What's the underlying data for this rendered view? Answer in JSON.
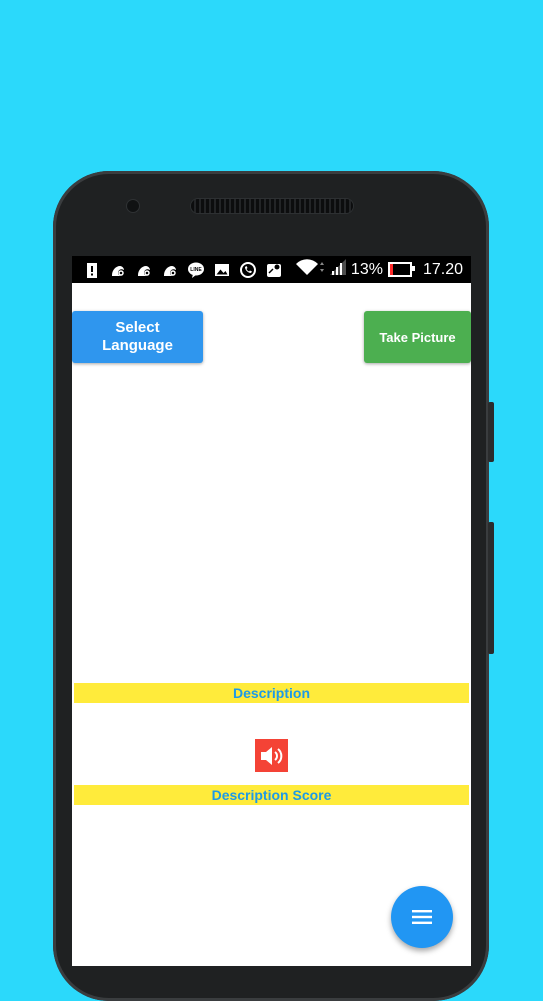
{
  "statusbar": {
    "battery_percent": "13%",
    "battery_level": 0.13,
    "time": "17.20",
    "notification_icons": [
      "alert-icon",
      "uc-browser-icon",
      "uc-browser-icon",
      "uc-browser-icon",
      "line-app-icon",
      "gallery-icon",
      "whatsapp-icon",
      "maps-icon"
    ],
    "line_label": "LINE"
  },
  "app": {
    "select_language_label": "Select Language",
    "take_picture_label": "Take Picture",
    "description_label": "Description",
    "description_score_label": "Description Score"
  },
  "colors": {
    "background": "#2bd9fb",
    "select_language_button": "#2f96ee",
    "take_picture_button": "#4caf50",
    "label_bar": "#ffeb3b",
    "label_text": "#1e9ae6",
    "speaker_button": "#f44336",
    "fab": "#2196f3"
  },
  "icons": {
    "speaker": "volume-icon",
    "fab": "menu-icon"
  }
}
